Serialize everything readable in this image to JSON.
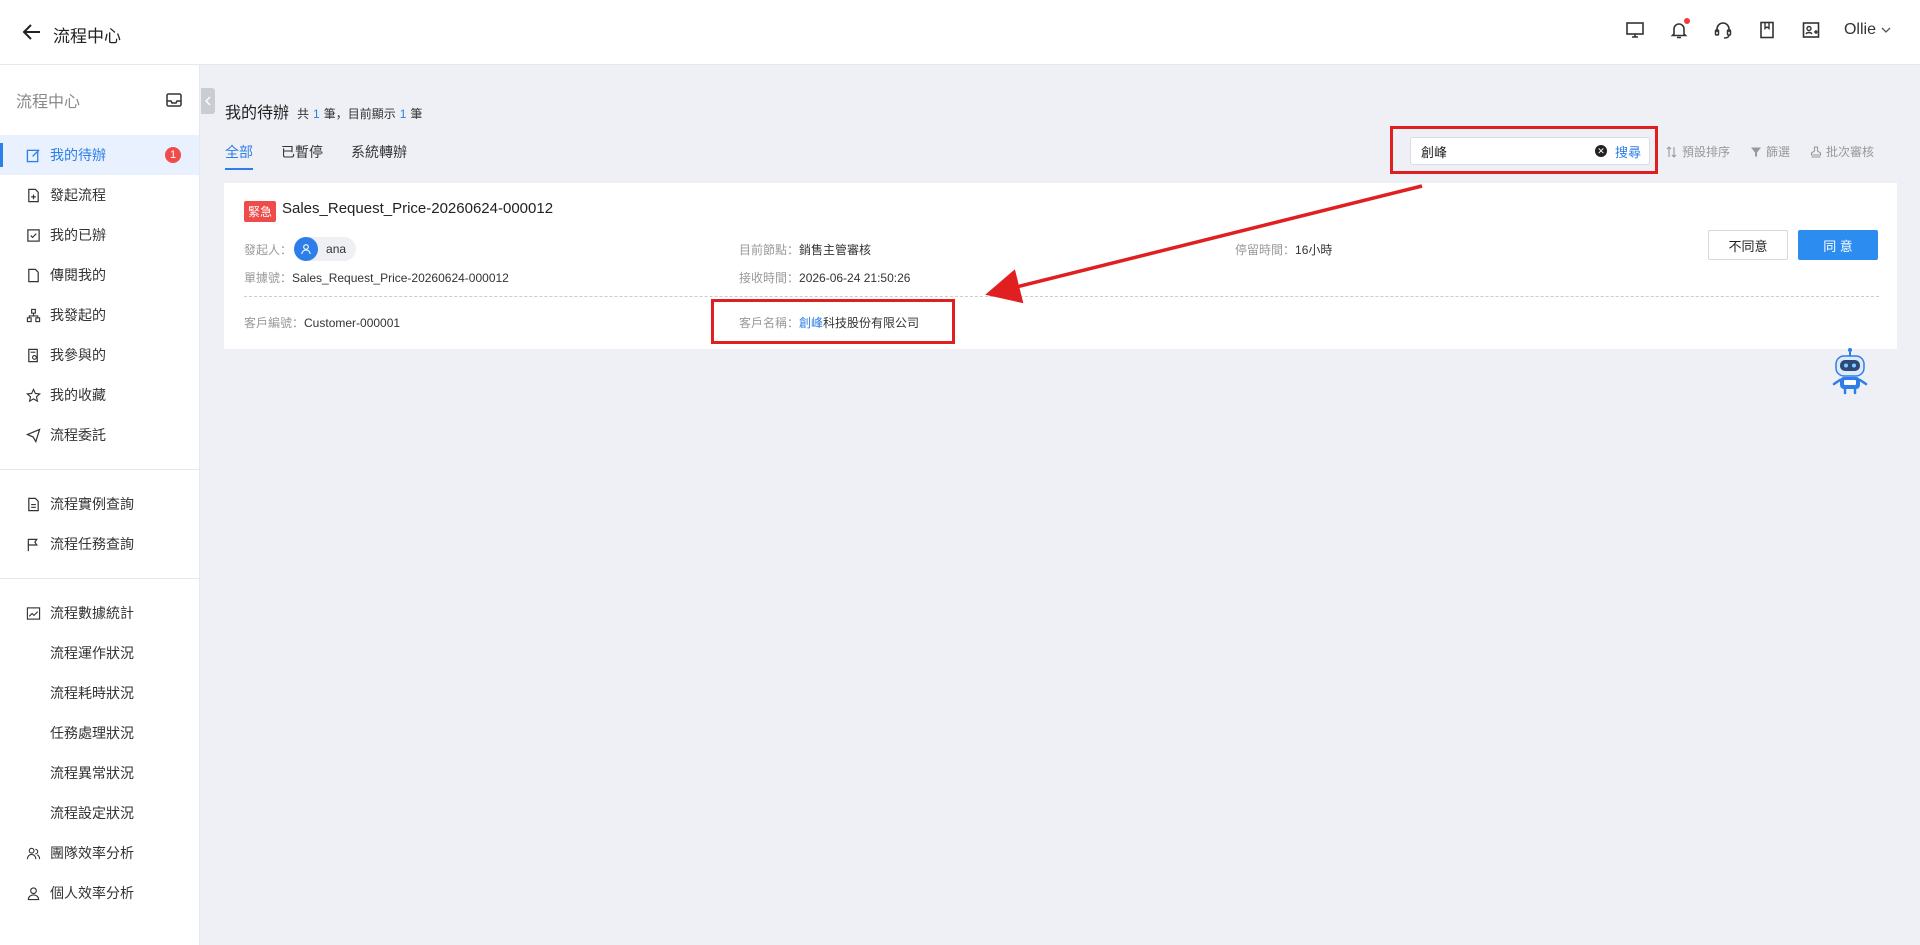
{
  "topbar": {
    "title": "流程中心",
    "user": "Ollie"
  },
  "sidebar": {
    "title": "流程中心",
    "items": [
      {
        "label": "我的待辦",
        "badge": "1"
      },
      {
        "label": "發起流程"
      },
      {
        "label": "我的已辦"
      },
      {
        "label": "傳閱我的"
      },
      {
        "label": "我發起的"
      },
      {
        "label": "我參與的"
      },
      {
        "label": "我的收藏"
      },
      {
        "label": "流程委託"
      }
    ],
    "items2": [
      {
        "label": "流程實例查詢"
      },
      {
        "label": "流程任務查詢"
      }
    ],
    "stats": {
      "label": "流程數據統計",
      "subs": [
        "流程運作狀況",
        "流程耗時狀況",
        "任務處理狀況",
        "流程異常狀況",
        "流程設定狀況"
      ]
    },
    "items3": [
      {
        "label": "團隊效率分析"
      },
      {
        "label": "個人效率分析"
      }
    ]
  },
  "main": {
    "title": "我的待辦",
    "count_prefix": "共",
    "total": "1",
    "count_mid": "筆，目前顯示",
    "shown": "1",
    "count_suffix": "筆",
    "tabs": [
      "全部",
      "已暫停",
      "系統轉辦"
    ],
    "search": {
      "value": "創峰",
      "button": "搜尋"
    },
    "tools": {
      "sort": "預設排序",
      "filter": "篩選",
      "batch": "批次審核"
    }
  },
  "card": {
    "tag": "緊急",
    "title": "Sales_Request_Price-20260624-000012",
    "initiator_label": "發起人：",
    "initiator": "ana",
    "node_label": "目前節點：",
    "node": "銷售主管審核",
    "stay_label": "停留時間：",
    "stay": "16小時",
    "doc_label": "單據號：",
    "doc": "Sales_Request_Price-20260624-000012",
    "recv_label": "接收時間：",
    "recv": "2026-06-24 21:50:26",
    "cust_no_label": "客戶編號：",
    "cust_no": "Customer-000001",
    "cust_name_label": "客戶名稱：",
    "cust_name_hl": "創峰",
    "cust_name_rest": "科技股份有限公司",
    "disagree": "不同意",
    "agree": "同 意"
  },
  "colors": {
    "accent": "#2d7ee8",
    "urgent": "#f04b4b",
    "annotation": "#e02020"
  }
}
